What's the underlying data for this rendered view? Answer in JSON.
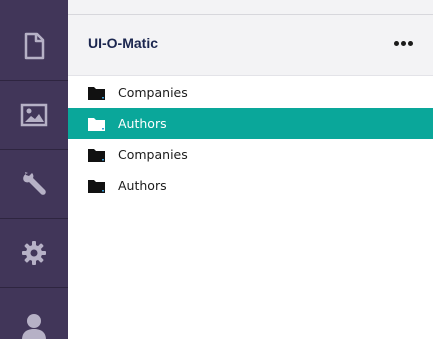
{
  "panel": {
    "title": "UI-O-Matic"
  },
  "sidebar": {
    "items": [
      {
        "icon": "document-icon"
      },
      {
        "icon": "image-icon"
      },
      {
        "icon": "wrench-icon"
      },
      {
        "icon": "gear-icon"
      },
      {
        "icon": "user-icon"
      }
    ]
  },
  "tree": {
    "items": [
      {
        "label": "Companies",
        "selected": false
      },
      {
        "label": "Authors",
        "selected": true
      },
      {
        "label": "Companies",
        "selected": false
      },
      {
        "label": "Authors",
        "selected": false
      }
    ]
  },
  "colors": {
    "sidebar": "#413659",
    "selected": "#0aa79a",
    "header_bg": "#f3f3f5",
    "title": "#1b264f"
  }
}
